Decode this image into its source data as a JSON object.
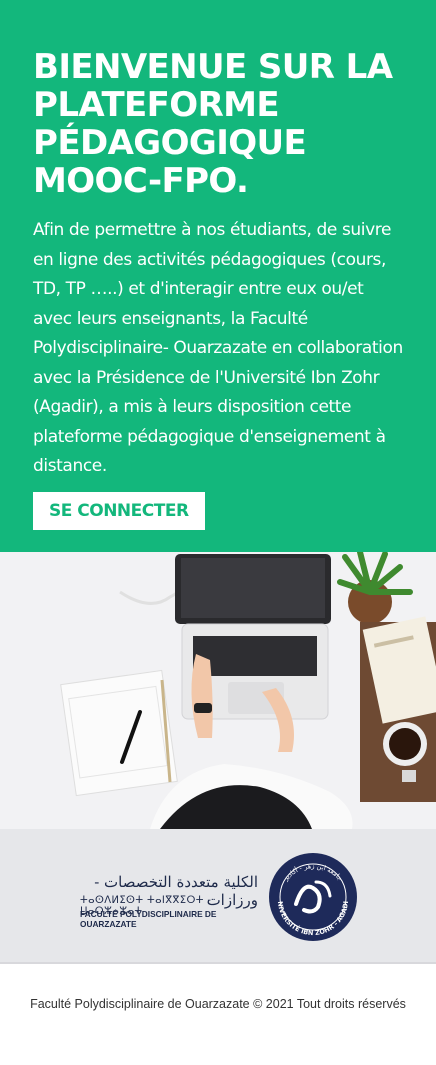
{
  "hero": {
    "title": "BIENVENUE SUR LA PLATEFORME PÉDAGOGIQUE MOOC-FPO.",
    "description": "Afin de permettre à nos étudiants, de suivre en ligne des activités pédagogiques (cours, TD, TP …..) et d'interagir entre eux ou/et avec leurs enseignants, la Faculté Polydisciplinaire- Ouarzazate en collaboration avec la Présidence de l'Université Ibn Zohr (Agadir), a mis à leurs disposition cette plateforme pédagogique d'enseignement à distance.",
    "login_button": "SE CONNECTER"
  },
  "logo": {
    "arabic_name": "الكلية متعددة التخصصات - ورزازات",
    "tifinagh_name": "ⵜⴰⵙⴷⵍⵉⵙⵜ ⵜⴰⵏⴳⴳⵉⵔⵜ - ⵡⴰⵔⵣⴰⵣⴰⵜ",
    "french_name": "FACULTÉ POLYDISCIPLINAIRE DE OUARZAZATE",
    "seal_arabic": "جامعة ابن زهر - أكادير",
    "seal_text": "UNIVERSITÉ IBN ZOHR - AGADIR",
    "seal_icon": "university-seal-icon"
  },
  "footer": {
    "copyright": "Faculté Polydisciplinaire de Ouarzazate © 2021 Tout droits réservés"
  },
  "colors": {
    "brand_green": "#13b77c",
    "navy": "#1e2a4a",
    "logo_band": "#e6e7ea"
  }
}
